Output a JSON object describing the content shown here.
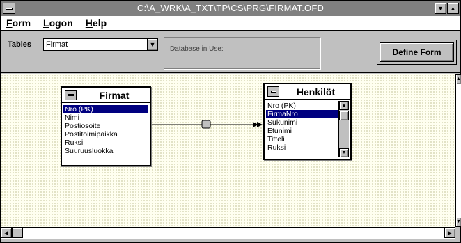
{
  "window": {
    "title": "C:\\A_WRK\\A_TXT\\TP\\CS\\PRG\\FIRMAT.OFD"
  },
  "menu": {
    "items": [
      {
        "label": "Form",
        "hotkey": "F",
        "rest": "orm"
      },
      {
        "label": "Logon",
        "hotkey": "L",
        "rest": "ogon"
      },
      {
        "label": "Help",
        "hotkey": "H",
        "rest": "elp"
      }
    ]
  },
  "toolbar": {
    "tables_label": "Tables",
    "tables_value": "Firmat",
    "db_label": "Database in Use:",
    "db_value": "",
    "define_label": "Define Form"
  },
  "tables": {
    "firmat": {
      "name": "Firmat",
      "fields": [
        "Nro  (PK)",
        "Nimi",
        "Postiosoite",
        "Postitoimipaikka",
        "Ruksi",
        "Suuruusluokka"
      ],
      "selected_index": 0
    },
    "henkilot": {
      "name": "Henkilöt",
      "fields": [
        "Nro  (PK)",
        "FirmaNro",
        "Sukunimi",
        "Etunimi",
        "Titteli",
        "Ruksi"
      ],
      "selected_index": 1
    }
  },
  "icons": {
    "arrow_down": "▼",
    "arrow_up": "▲",
    "arrow_left": "◀",
    "arrow_right": "▶"
  }
}
